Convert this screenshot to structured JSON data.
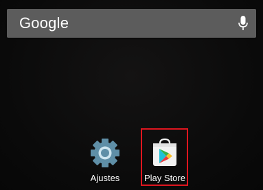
{
  "search": {
    "logo_text": "Google",
    "mic_icon": "mic-icon"
  },
  "apps": [
    {
      "label": "Ajustes",
      "icon": "settings-gear-icon"
    },
    {
      "label": "Play Store",
      "icon": "play-store-icon"
    }
  ],
  "colors": {
    "search_bar": "#5c5c5c",
    "highlight_border": "#e0161f",
    "gear": "#5f8fa7"
  }
}
